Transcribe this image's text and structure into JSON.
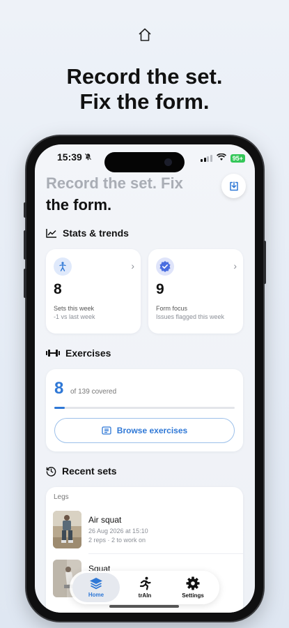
{
  "headline": {
    "line1": "Record the set.",
    "line2": "Fix the form."
  },
  "icons": {
    "top": "home-outline-icon",
    "mute": "bell-slash-icon",
    "download": "download-tray-icon"
  },
  "status_bar": {
    "time": "15:39",
    "battery": "95+"
  },
  "page_title": {
    "faded": "Record the set. Fix",
    "solid": "the form."
  },
  "stats": {
    "heading": "Stats & trends",
    "cards": [
      {
        "value": "8",
        "title": "Sets this week",
        "subtitle": "-1 vs last week",
        "icon": "person-figure-icon"
      },
      {
        "value": "9",
        "title": "Form focus",
        "subtitle": "Issues flagged this week",
        "icon": "verified-badge-icon"
      }
    ]
  },
  "exercises": {
    "heading": "Exercises",
    "covered": "8",
    "covered_text": "of 139 covered",
    "progress": 0.058,
    "button": "Browse exercises"
  },
  "recent": {
    "heading": "Recent sets",
    "group": "Legs",
    "items": [
      {
        "name": "Air squat",
        "date": "26 Aug 2026 at 15:10",
        "meta": "2 reps · 2 to work on"
      },
      {
        "name": "Squat",
        "date": "",
        "meta": ""
      }
    ]
  },
  "tabbar": {
    "tabs": [
      "Home",
      "trAIn",
      "Settings"
    ],
    "active": "Home"
  },
  "colors": {
    "accent": "#2f78d6",
    "battery": "#34c759",
    "stat_icon_bg": "#dfe9fb",
    "focus_badge": "#4a6ee0"
  }
}
